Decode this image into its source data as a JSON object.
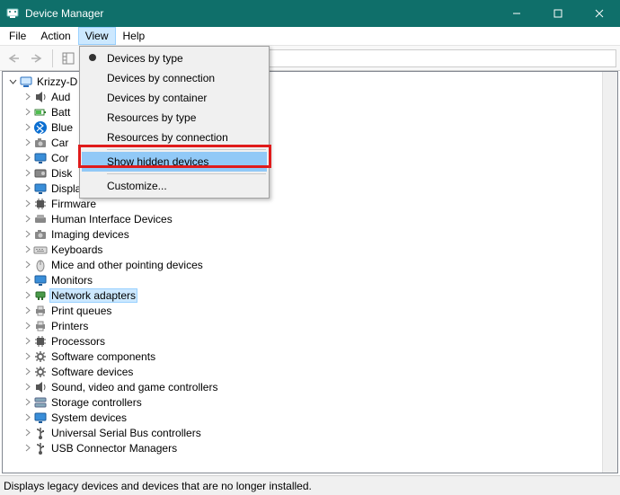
{
  "window": {
    "title": "Device Manager"
  },
  "menubar": {
    "file": "File",
    "action": "Action",
    "view": "View",
    "help": "Help"
  },
  "view_menu": {
    "by_type": "Devices by type",
    "by_connection": "Devices by connection",
    "by_container": "Devices by container",
    "res_type": "Resources by type",
    "res_connection": "Resources by connection",
    "show_hidden": "Show hidden devices",
    "customize": "Customize..."
  },
  "tree": {
    "root": "Krizzy-D",
    "items": [
      {
        "label": "Aud",
        "selected": false
      },
      {
        "label": "Batt",
        "selected": false
      },
      {
        "label": "Blue",
        "selected": false
      },
      {
        "label": "Car",
        "selected": false
      },
      {
        "label": "Cor",
        "selected": false
      },
      {
        "label": "Disk",
        "selected": false
      },
      {
        "label": "Display adapters",
        "selected": false,
        "cut": true
      },
      {
        "label": "Firmware",
        "selected": false
      },
      {
        "label": "Human Interface Devices",
        "selected": false
      },
      {
        "label": "Imaging devices",
        "selected": false
      },
      {
        "label": "Keyboards",
        "selected": false
      },
      {
        "label": "Mice and other pointing devices",
        "selected": false
      },
      {
        "label": "Monitors",
        "selected": false
      },
      {
        "label": "Network adapters",
        "selected": true
      },
      {
        "label": "Print queues",
        "selected": false
      },
      {
        "label": "Printers",
        "selected": false
      },
      {
        "label": "Processors",
        "selected": false
      },
      {
        "label": "Software components",
        "selected": false
      },
      {
        "label": "Software devices",
        "selected": false
      },
      {
        "label": "Sound, video and game controllers",
        "selected": false
      },
      {
        "label": "Storage controllers",
        "selected": false
      },
      {
        "label": "System devices",
        "selected": false
      },
      {
        "label": "Universal Serial Bus controllers",
        "selected": false
      },
      {
        "label": "USB Connector Managers",
        "selected": false
      }
    ]
  },
  "statusbar": {
    "text": "Displays legacy devices and devices that are no longer installed."
  }
}
